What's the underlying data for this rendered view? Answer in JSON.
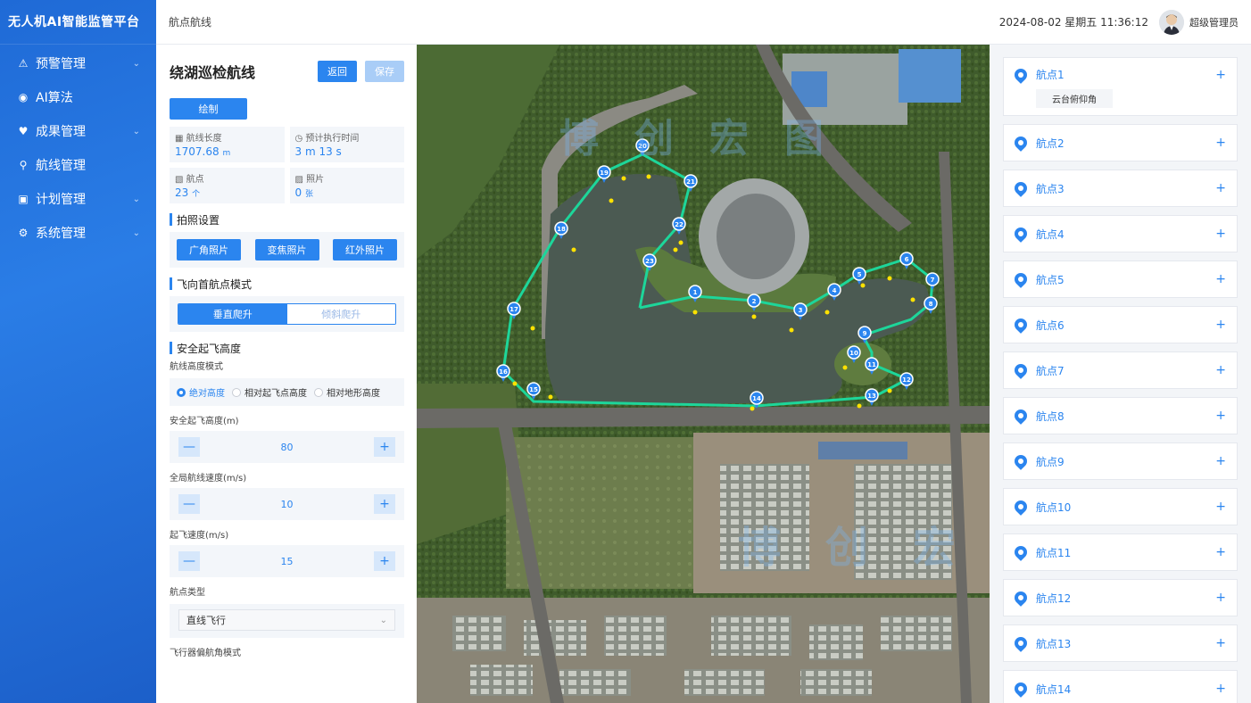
{
  "app": {
    "title": "无人机AI智能监管平台"
  },
  "sidebar": {
    "items": [
      {
        "label": "预警管理",
        "icon": "warning-icon",
        "chevron": true
      },
      {
        "label": "AI算法",
        "icon": "ai-icon",
        "chevron": false
      },
      {
        "label": "成果管理",
        "icon": "result-icon",
        "chevron": true
      },
      {
        "label": "航线管理",
        "icon": "route-icon",
        "chevron": false
      },
      {
        "label": "计划管理",
        "icon": "plan-icon",
        "chevron": true
      },
      {
        "label": "系统管理",
        "icon": "gear-icon",
        "chevron": true
      }
    ]
  },
  "header": {
    "breadcrumb": "航点航线",
    "datetime": "2024-08-02 星期五 11:36:12",
    "user": "超级管理员"
  },
  "route": {
    "title": "绕湖巡检航线",
    "back_label": "返回",
    "save_label": "保存",
    "draw_label": "绘制",
    "stats": {
      "length_label": "航线长度",
      "length_value": "1707.68",
      "length_unit": "m",
      "time_label": "预计执行时间",
      "time_value": "3 m 13 s",
      "points_label": "航点",
      "points_value": "23",
      "points_unit": "个",
      "photos_label": "照片",
      "photos_value": "0",
      "photos_unit": "张"
    },
    "photo_section": "拍照设置",
    "photo_buttons": [
      "广角照片",
      "变焦照片",
      "红外照片"
    ],
    "first_point_section": "飞向首航点模式",
    "climb_modes": {
      "active": "垂直爬升",
      "inactive": "倾斜爬升"
    },
    "safe_height_section": "安全起飞高度",
    "height_mode_label": "航线高度模式",
    "height_modes": [
      {
        "label": "绝对高度",
        "selected": true
      },
      {
        "label": "相对起飞点高度",
        "selected": false
      },
      {
        "label": "相对地形高度",
        "selected": false
      }
    ],
    "safe_height_label": "安全起飞高度(m)",
    "safe_height_value": "80",
    "global_speed_label": "全局航线速度(m/s)",
    "global_speed_value": "10",
    "takeoff_speed_label": "起飞速度(m/s)",
    "takeoff_speed_value": "15",
    "waypoint_type_label": "航点类型",
    "waypoint_type_value": "直线飞行",
    "yaw_mode_label": "飞行器偏航角模式",
    "minus": "—",
    "plus": "+"
  },
  "waypoints": [
    {
      "label": "航点1",
      "tag": "云台俯仰角"
    },
    {
      "label": "航点2"
    },
    {
      "label": "航点3"
    },
    {
      "label": "航点4"
    },
    {
      "label": "航点5"
    },
    {
      "label": "航点6"
    },
    {
      "label": "航点7"
    },
    {
      "label": "航点8"
    },
    {
      "label": "航点9"
    },
    {
      "label": "航点10"
    },
    {
      "label": "航点11"
    },
    {
      "label": "航点12"
    },
    {
      "label": "航点13"
    },
    {
      "label": "航点14"
    }
  ],
  "map_markers": [
    "1",
    "2",
    "3",
    "4",
    "5",
    "6",
    "7",
    "8",
    "9",
    "10",
    "11",
    "12",
    "13",
    "14",
    "15",
    "16",
    "17",
    "18",
    "19",
    "20",
    "21",
    "22",
    "23"
  ],
  "watermark": "博创宏图",
  "colors": {
    "accent": "#2b85ef",
    "route": "#1dd69a",
    "sidebar": "#1f6ad6"
  }
}
